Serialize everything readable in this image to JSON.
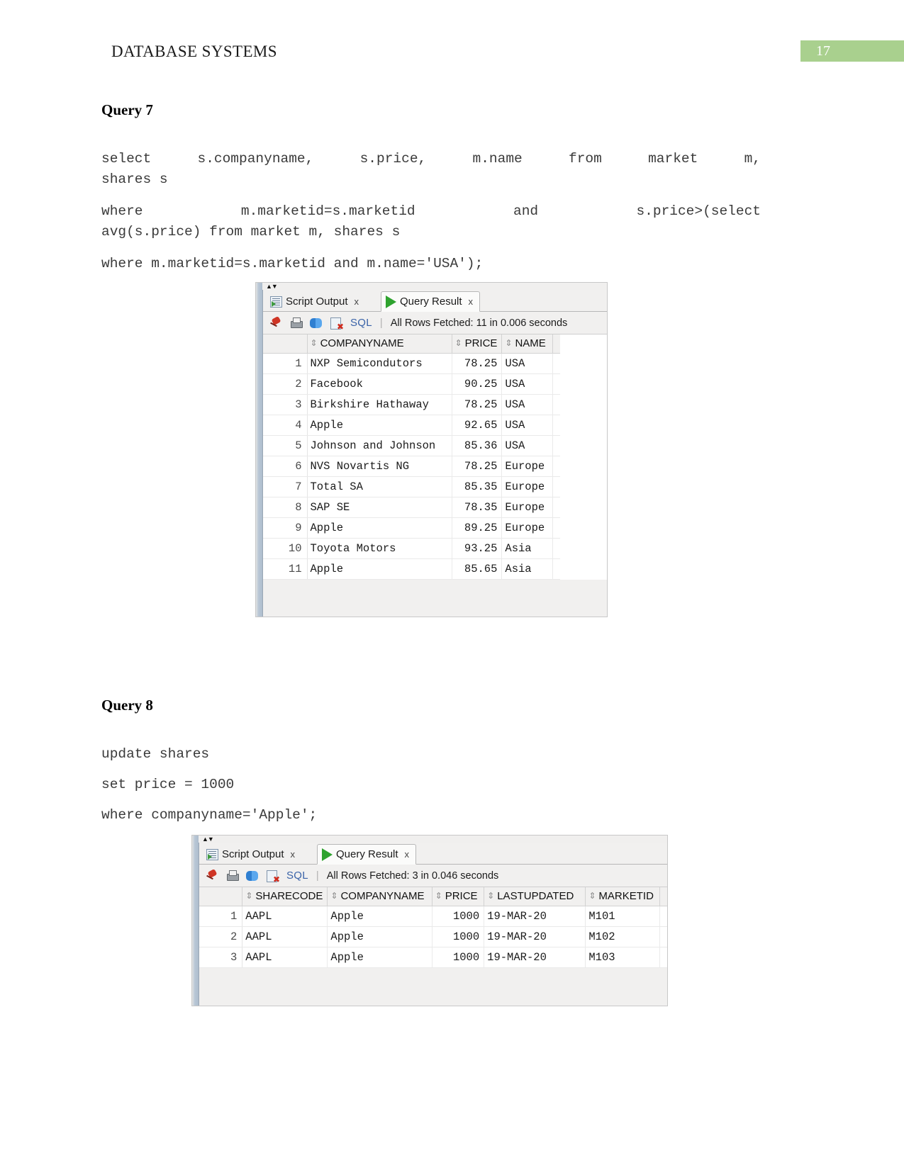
{
  "header": {
    "title": "DATABASE SYSTEMS",
    "page_number": "17",
    "badge_color": "#a9d08e"
  },
  "sections": [
    {
      "heading": "Query 7",
      "sql_lines": [
        "select  s.companyname,  s.price,  m.name  from  market  m,",
        "shares s",
        "where    m.marketid=s.marketid    and    s.price>(select",
        "avg(s.price) from market m, shares s",
        "where m.marketid=s.marketid and m.name='USA');"
      ]
    },
    {
      "heading": "Query 8",
      "sql_lines": [
        "update shares",
        "set price = 1000",
        "where companyname='Apple';"
      ]
    }
  ],
  "screenshot1": {
    "tabs": [
      {
        "label": "Script Output",
        "icon": "script-output-icon",
        "close": "x",
        "active": false
      },
      {
        "label": "Query Result",
        "icon": "play-green-icon",
        "close": "x",
        "active": true
      }
    ],
    "toolbar": {
      "icons": [
        "pin-icon",
        "print-icon",
        "refresh-icon",
        "cancel-icon"
      ],
      "sql_label": "SQL",
      "separator": "|",
      "status": "All Rows Fetched: 11 in 0.006 seconds"
    },
    "grid": {
      "columns": [
        "COMPANYNAME",
        "PRICE",
        "NAME"
      ],
      "sort_glyph": "⇕",
      "rows": [
        {
          "n": "1",
          "companyname": "NXP Semicondutors",
          "price": "78.25",
          "name": "USA"
        },
        {
          "n": "2",
          "companyname": "Facebook",
          "price": "90.25",
          "name": "USA"
        },
        {
          "n": "3",
          "companyname": "Birkshire Hathaway",
          "price": "78.25",
          "name": "USA"
        },
        {
          "n": "4",
          "companyname": "Apple",
          "price": "92.65",
          "name": "USA"
        },
        {
          "n": "5",
          "companyname": "Johnson and Johnson",
          "price": "85.36",
          "name": "USA"
        },
        {
          "n": "6",
          "companyname": "NVS Novartis NG",
          "price": "78.25",
          "name": "Europe"
        },
        {
          "n": "7",
          "companyname": "Total SA",
          "price": "85.35",
          "name": "Europe"
        },
        {
          "n": "8",
          "companyname": "SAP SE",
          "price": "78.35",
          "name": "Europe"
        },
        {
          "n": "9",
          "companyname": "Apple",
          "price": "89.25",
          "name": "Europe"
        },
        {
          "n": "10",
          "companyname": "Toyota Motors",
          "price": "93.25",
          "name": "Asia"
        },
        {
          "n": "11",
          "companyname": "Apple",
          "price": "85.65",
          "name": "Asia"
        }
      ]
    }
  },
  "screenshot2": {
    "tabs": [
      {
        "label": "Script Output",
        "icon": "script-output-icon",
        "close": "x",
        "active": false
      },
      {
        "label": "Query Result",
        "icon": "play-green-icon",
        "close": "x",
        "active": true
      }
    ],
    "toolbar": {
      "icons": [
        "pin-icon",
        "print-icon",
        "refresh-icon",
        "cancel-icon"
      ],
      "sql_label": "SQL",
      "separator": "|",
      "status": "All Rows Fetched: 3 in 0.046 seconds"
    },
    "grid": {
      "columns": [
        "SHARECODE",
        "COMPANYNAME",
        "PRICE",
        "LASTUPDATED",
        "MARKETID"
      ],
      "sort_glyph": "⇕",
      "rows": [
        {
          "n": "1",
          "sharecode": "AAPL",
          "companyname": "Apple",
          "price": "1000",
          "lastupdated": "19-MAR-20",
          "marketid": "M101"
        },
        {
          "n": "2",
          "sharecode": "AAPL",
          "companyname": "Apple",
          "price": "1000",
          "lastupdated": "19-MAR-20",
          "marketid": "M102"
        },
        {
          "n": "3",
          "sharecode": "AAPL",
          "companyname": "Apple",
          "price": "1000",
          "lastupdated": "19-MAR-20",
          "marketid": "M103"
        }
      ]
    }
  }
}
